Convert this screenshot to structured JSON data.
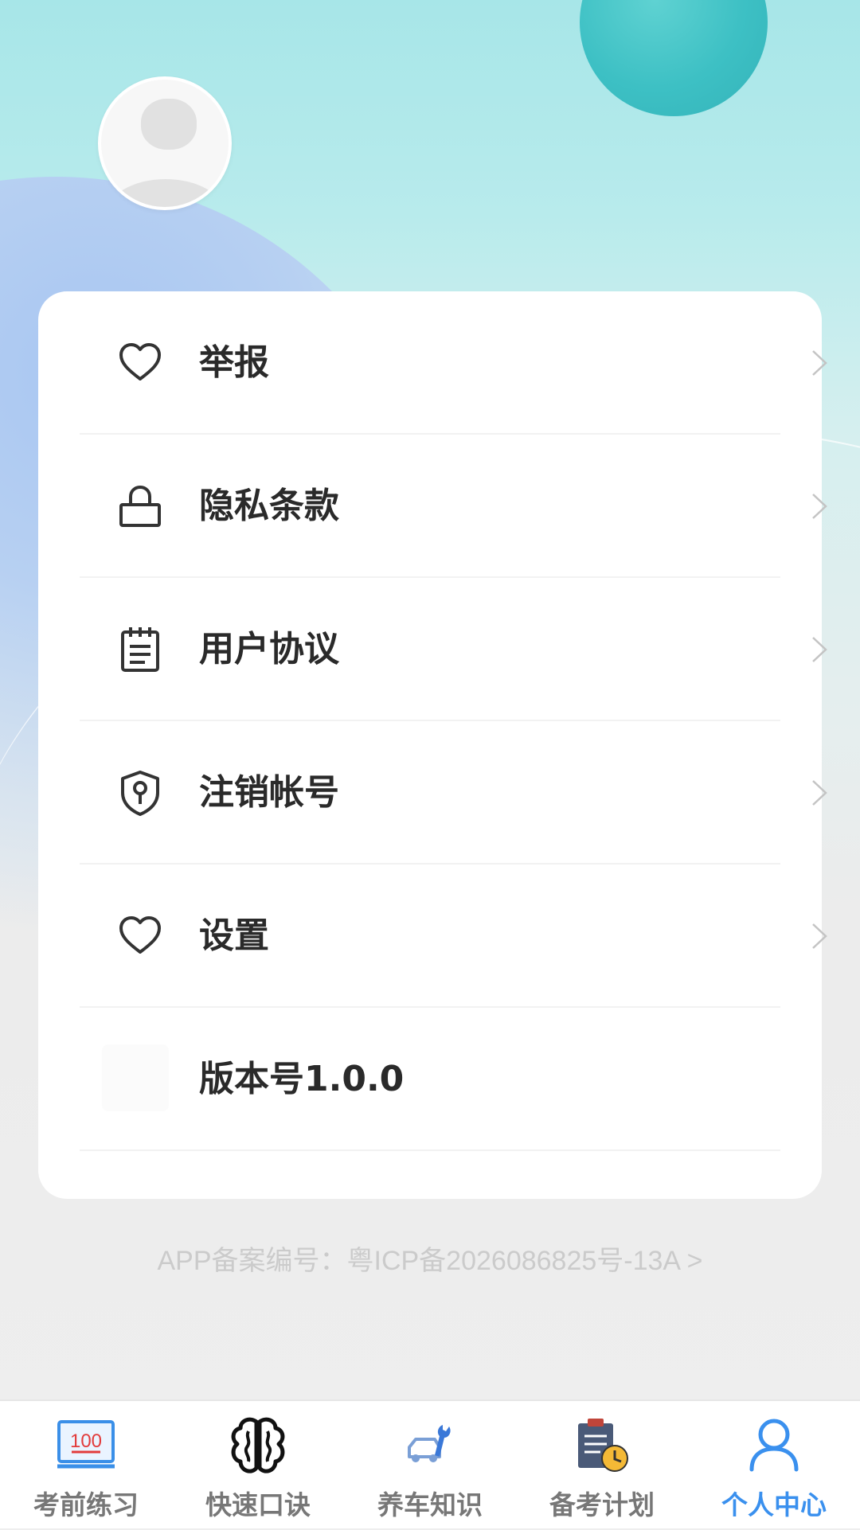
{
  "profile": {
    "avatar_icon": "user-avatar-placeholder"
  },
  "menu": {
    "items": [
      {
        "label": "举报",
        "icon": "heart-icon"
      },
      {
        "label": "隐私条款",
        "icon": "lock-icon"
      },
      {
        "label": "用户协议",
        "icon": "notepad-icon"
      },
      {
        "label": "注销帐号",
        "icon": "shield-keyhole-icon"
      },
      {
        "label": "设置",
        "icon": "heart-icon"
      },
      {
        "label": "版本号1.0.0",
        "icon": ""
      }
    ]
  },
  "footer": {
    "icp_text": "APP备案编号：粤ICP备2026086825号-13A >"
  },
  "tabbar": {
    "tabs": [
      {
        "label": "考前练习",
        "icon": "score-100-icon"
      },
      {
        "label": "快速口诀",
        "icon": "brain-icon"
      },
      {
        "label": "养车知识",
        "icon": "car-wrench-icon"
      },
      {
        "label": "备考计划",
        "icon": "clipboard-clock-icon"
      },
      {
        "label": "个人中心",
        "icon": "person-icon"
      }
    ],
    "active_index": 4,
    "active_color": "#3a90ee",
    "inactive_color": "#777777"
  }
}
